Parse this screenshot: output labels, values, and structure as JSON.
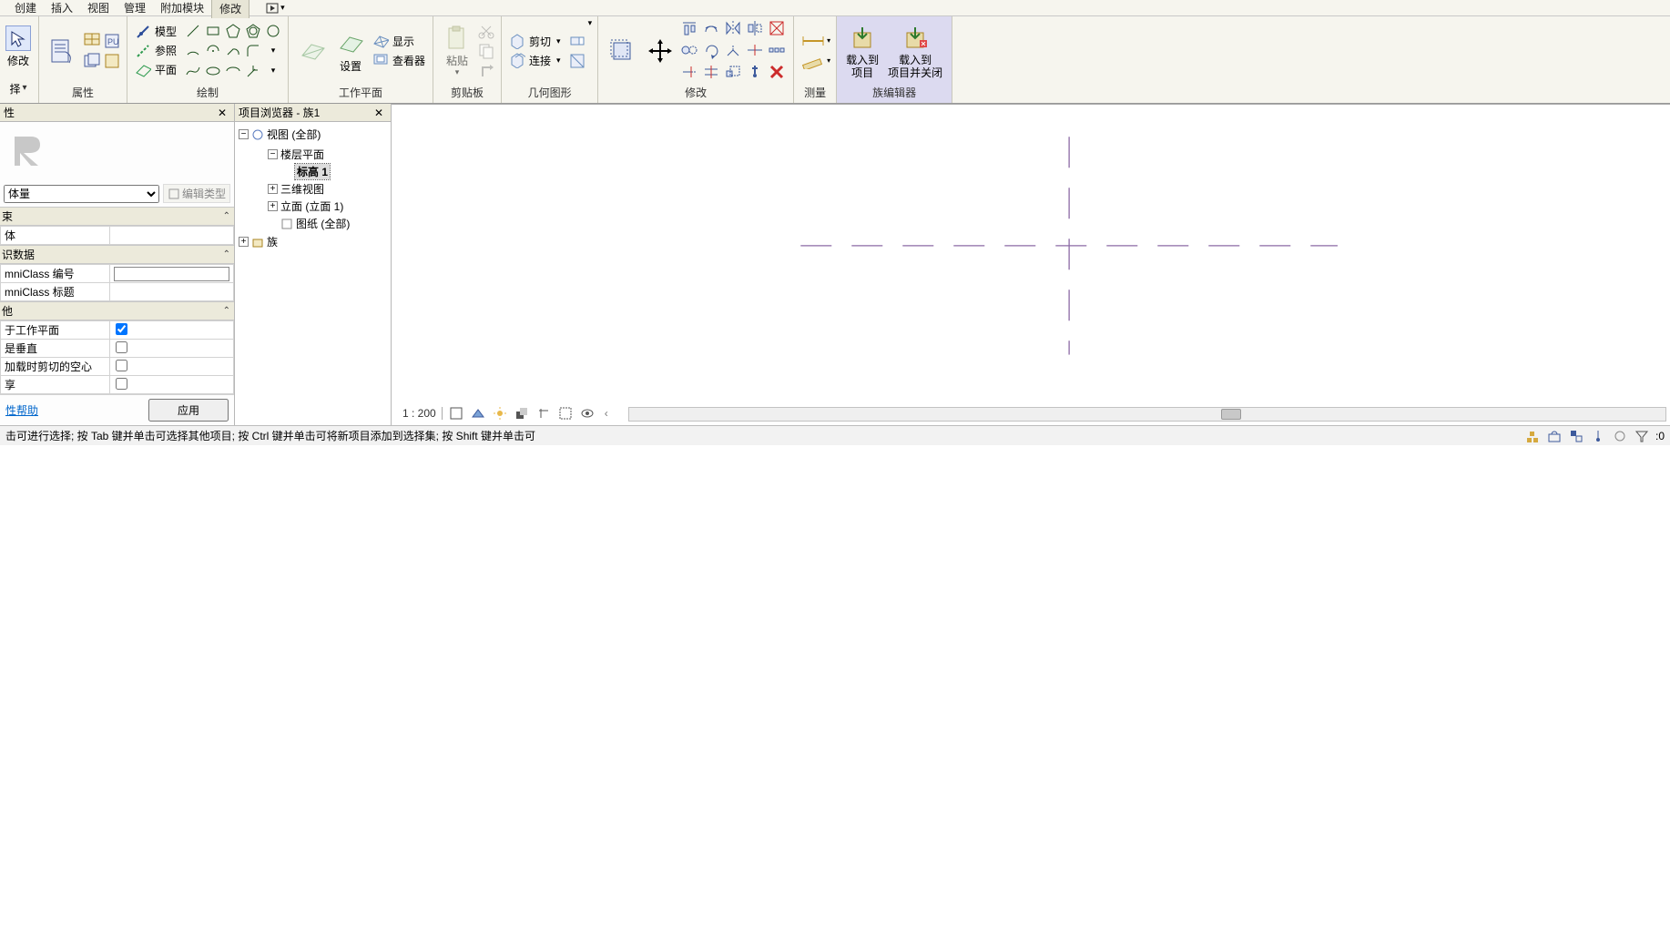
{
  "menu": {
    "items": [
      "创建",
      "插入",
      "视图",
      "管理",
      "附加模块",
      "修改"
    ],
    "activeIndex": 5
  },
  "ribbon": {
    "panels": {
      "select": {
        "label": "择",
        "modify": "修改"
      },
      "properties": {
        "title": "属性"
      },
      "draw": {
        "title": "绘制",
        "model": "模型",
        "ref": "参照",
        "plane": "平面"
      },
      "workplane": {
        "title": "工作平面",
        "set": "设置",
        "show": "显示",
        "viewer": "查看器"
      },
      "clipboard": {
        "title": "剪贴板",
        "paste": "粘贴"
      },
      "geometry": {
        "title": "几何图形",
        "cut": "剪切",
        "join": "连接"
      },
      "modify": {
        "title": "修改"
      },
      "measure": {
        "title": "测量"
      },
      "familyeditor": {
        "title": "族编辑器",
        "loadProject": "载入到\n项目",
        "loadProjectClose": "载入到\n项目并关闭"
      }
    }
  },
  "propertiesPanel": {
    "title": "性",
    "typeSelector": "体量",
    "editTypeLabel": "编辑类型",
    "categories": {
      "constraints": "束",
      "constraintsRow1": "体",
      "identity": "识数据",
      "other": "他"
    },
    "rows": {
      "omniNumber": {
        "label": "mniClass 编号",
        "value": ""
      },
      "omniTitle": {
        "label": "mniClass 标题",
        "value": ""
      },
      "workplaneBased": {
        "label": "于工作平面",
        "checked": true
      },
      "alwaysVertical": {
        "label": "是垂直",
        "checked": false
      },
      "cutWithVoids": {
        "label": "加载时剪切的空心",
        "checked": false
      },
      "shared": {
        "label": "享",
        "checked": false
      }
    },
    "helpLink": "性帮助",
    "applyButton": "应用"
  },
  "browserPanel": {
    "title": "项目浏览器 - 族1",
    "tree": {
      "root": {
        "label": "视图 (全部)",
        "expanded": true
      },
      "floorPlans": {
        "label": "楼层平面",
        "expanded": true
      },
      "level1": {
        "label": "标高 1",
        "bold": true,
        "selected": true
      },
      "threeD": {
        "label": "三维视图",
        "expanded": false
      },
      "elevations": {
        "label": "立面 (立面 1)",
        "expanded": false
      },
      "sheets": {
        "label": "图纸 (全部)"
      },
      "families": {
        "label": "族",
        "expanded": false
      }
    }
  },
  "viewControls": {
    "scale": "1  :  200"
  },
  "scrollbar": {
    "thumbLeft": 650,
    "thumbWidth": 22
  },
  "statusBar": {
    "hint": "击可进行选择; 按 Tab 键并单击可选择其他项目; 按 Ctrl 键并单击可将新项目添加到选择集; 按 Shift 键并单击可",
    "filterCount": ":0"
  },
  "colors": {
    "accent": "#8b6aa5",
    "ribbonBg": "#f6f5ee",
    "highlightPanel": "#dcdaf0"
  }
}
